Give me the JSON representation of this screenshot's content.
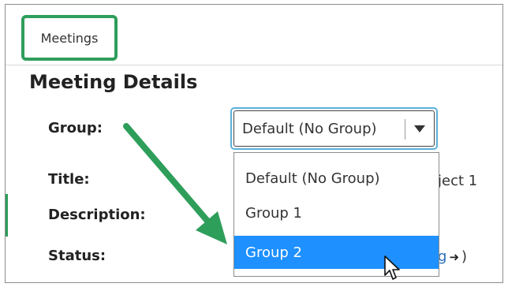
{
  "breadcrumb": {
    "label": "Meetings"
  },
  "page": {
    "title": "Meeting Details"
  },
  "form": {
    "group_label": "Group:",
    "title_label": "Title:",
    "description_label": "Description:",
    "status_label": "Status:",
    "title_value_partial": "ject 1",
    "status_value_partial": "g",
    "status_paren": ")"
  },
  "group_select": {
    "selected": "Default (No Group)",
    "options": [
      "Default (No Group)",
      "Group 1",
      "Group 2"
    ],
    "highlighted_index": 2
  },
  "colors": {
    "annotation_green": "#2e9e5b",
    "focus_ring": "#5bb0d9",
    "highlight": "#1e90ff",
    "link": "#2b6fb8"
  },
  "icons": [
    "caret-down-icon",
    "enter-icon",
    "mouse-pointer-icon",
    "annotation-arrow"
  ]
}
